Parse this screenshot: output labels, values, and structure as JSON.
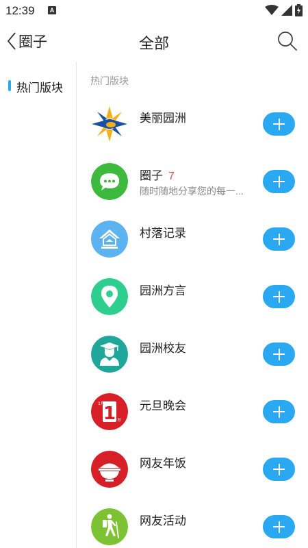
{
  "status_bar": {
    "time": "12:39",
    "notification_badge": "A",
    "icons": [
      "wifi-icon",
      "signal-icon",
      "battery-charging-icon"
    ]
  },
  "header": {
    "back_label": "圈子",
    "title": "全部",
    "search_icon": "search-icon"
  },
  "sidebar": {
    "items": [
      {
        "label": "热门版块",
        "selected": true
      }
    ],
    "accent_color": "#29a8f0"
  },
  "main": {
    "section_title": "热门版块",
    "items": [
      {
        "title": "美丽园洲",
        "count": "",
        "desc": "",
        "icon": "handshake-logo-icon",
        "icon_color": "#1a4fa3"
      },
      {
        "title": "圈子",
        "count": "7",
        "desc": "随时随地分享您的每一...",
        "icon": "chat-bubble-icon",
        "icon_color": "#3dba3d"
      },
      {
        "title": "村落记录",
        "count": "",
        "desc": "",
        "icon": "house-icon",
        "icon_color": "#5db3f0"
      },
      {
        "title": "园洲方言",
        "count": "",
        "desc": "",
        "icon": "location-pin-icon",
        "icon_color": "#2ecf8e"
      },
      {
        "title": "园洲校友",
        "count": "",
        "desc": "",
        "icon": "graduate-icon",
        "icon_color": "#1ea79a"
      },
      {
        "title": "元旦晚会",
        "count": "",
        "desc": "",
        "icon": "calendar-jan-1-icon",
        "icon_color": "#d61f26",
        "icon_text_month": "1月",
        "icon_text_day": "1",
        "icon_text_unit": "日"
      },
      {
        "title": "网友年饭",
        "count": "",
        "desc": "",
        "icon": "rice-bowl-icon",
        "icon_color": "#d61f26"
      },
      {
        "title": "网友活动",
        "count": "",
        "desc": "",
        "icon": "hiker-icon",
        "icon_color": "#7dc233"
      }
    ],
    "join_button_color": "#2aa8f2",
    "join_button_icon": "plus-icon"
  }
}
